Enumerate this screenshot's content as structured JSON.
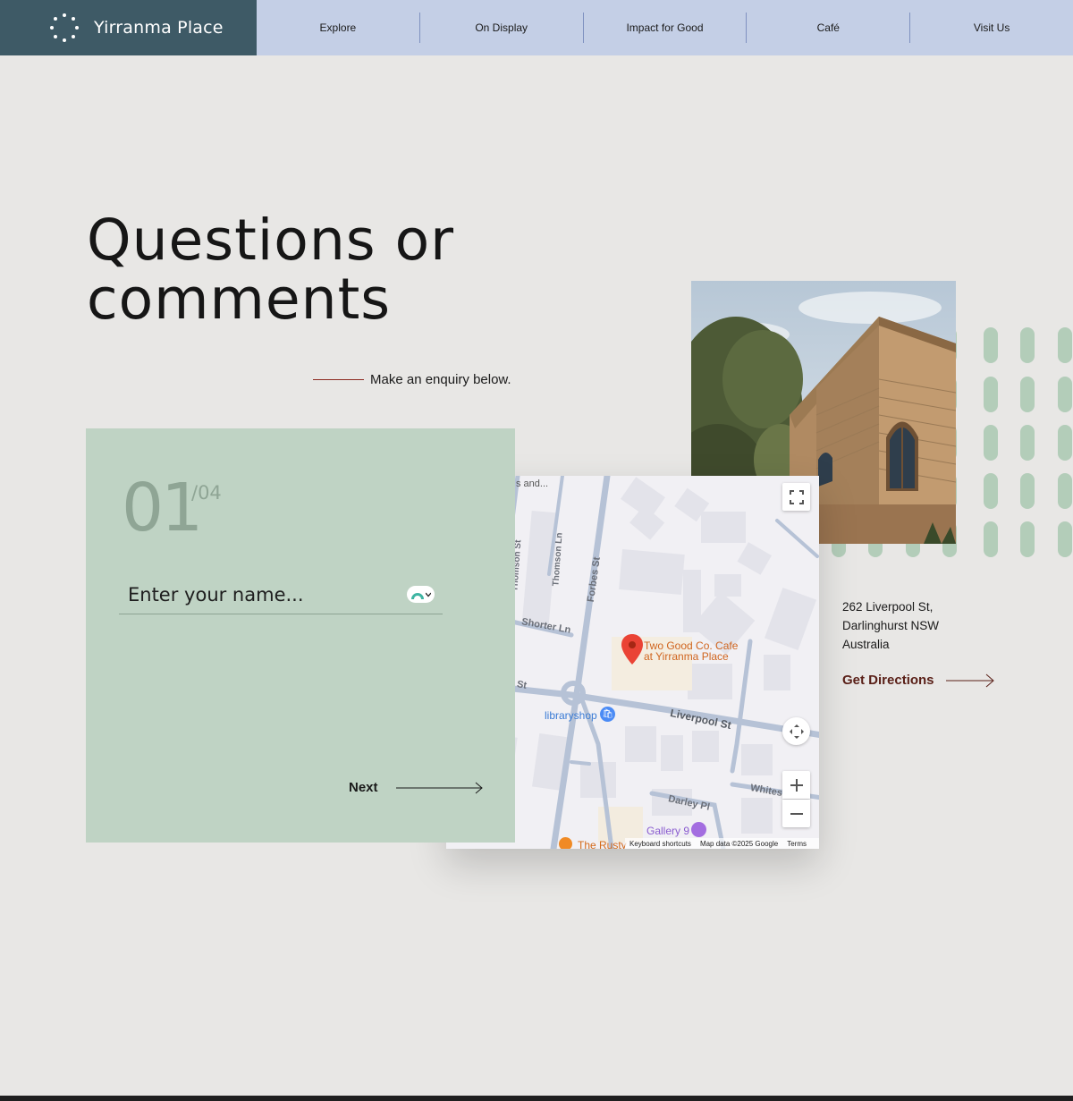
{
  "brand": {
    "name": "Yirranma Place"
  },
  "nav": {
    "items": [
      {
        "label": "Explore"
      },
      {
        "label": "On Display"
      },
      {
        "label": "Impact for Good"
      },
      {
        "label": "Café"
      },
      {
        "label": "Visit Us"
      }
    ]
  },
  "hero": {
    "title_line1": "Questions or",
    "title_line2": "comments",
    "enquiry_text": "Make an enquiry below."
  },
  "form": {
    "step": "01",
    "total": "/04",
    "name_placeholder": "Enter your name...",
    "next_label": "Next"
  },
  "map": {
    "place_line1": "Two Good Co. Cafe",
    "place_line2": "at Yirranma Place",
    "streets": {
      "thomson_st": "Thomson St",
      "thomson_ln": "Thomson Ln",
      "forbes_st": "Forbes St",
      "shorter_ln": "Shorter Ln",
      "st": "St",
      "liverpool_st": "Liverpool St",
      "darley_pl": "Darley Pl",
      "whites": "Whites"
    },
    "poi": {
      "libraryshop": "libraryshop",
      "gallery9": "Gallery 9",
      "rusty": "The Rusty",
      "top_fragment": "s and..."
    },
    "footer": {
      "shortcuts": "Keyboard shortcuts",
      "mapdata": "Map data ©2025 Google",
      "terms": "Terms"
    }
  },
  "address": {
    "line1": "262 Liverpool St,",
    "line2": "Darlinghurst NSW",
    "line3": "Australia",
    "directions_label": "Get Directions"
  },
  "colors": {
    "brand_bg": "#3e5a66",
    "nav_bg": "#c4cfe6",
    "card_bg": "#bfd3c4",
    "accent_red": "#8c2a20",
    "directions_text": "#5a2018"
  }
}
